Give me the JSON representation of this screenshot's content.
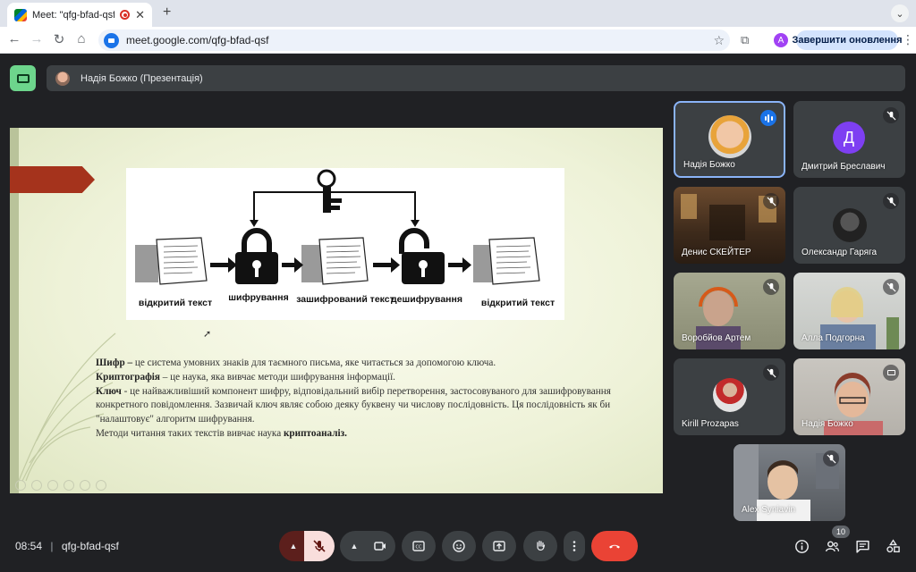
{
  "browser": {
    "tab_title": "Meet: \"qfg-bfad-qsf\"",
    "url": "meet.google.com/qfg-bfad-qsf",
    "profile_initial": "A",
    "update_label": "Завершити оновлення"
  },
  "presenter": {
    "label": "Надія Божко (Презентація)"
  },
  "slide": {
    "diagram_labels": {
      "plain_left": "відкритий текст",
      "encrypt": "шифрування",
      "cipher": "зашифрований текст",
      "decrypt": "дешифрування",
      "plain_right": "відкритий текст"
    },
    "paragraphs": [
      {
        "term": "Шифр –",
        "text": " це система умовних знаків для таємного письма, яке читається за допомогою ключа."
      },
      {
        "term": "Криптографія",
        "text": " – це наука, яка вивчає методи шифрування інформації."
      },
      {
        "term": "Ключ",
        "text": " - це найважливіший компонент шифру, відповідальний вибір перетворення, застосовуваного для зашифровування конкретного повідомлення. Зазвичай ключ являє собою деяку буквену чи числову послідовність. Ця послідовність як би \"налаштовує\" алгоритм шифрування."
      },
      {
        "term": "",
        "text": "Методи читання таких текстів вивчає наука ",
        "tail_bold": "криптоаналіз."
      }
    ]
  },
  "participants": [
    {
      "name": "Надія Божко",
      "state": "speaking"
    },
    {
      "name": "Дмитрий Бреславич",
      "state": "muted",
      "initial": "Д"
    },
    {
      "name": "Денис СКЕЙТЕР",
      "state": "muted"
    },
    {
      "name": "Олександр Гаряга",
      "state": "muted"
    },
    {
      "name": "Воробйов Артем",
      "state": "muted"
    },
    {
      "name": "Алла Подгорна",
      "state": "muted"
    },
    {
      "name": "Kirill Prozapas",
      "state": "muted"
    },
    {
      "name": "Надія Божко",
      "state": "presenting"
    },
    {
      "name": "Alex Syniavin",
      "state": "muted"
    }
  ],
  "meeting": {
    "time": "08:54",
    "separator": "|",
    "code": "qfg-bfad-qsf",
    "people_count": "10"
  },
  "colors": {
    "accent": "#8ab4f8",
    "end_call": "#ea4335",
    "mic_off_bg": "#f9dedc",
    "slide_tag": "#a5331c"
  }
}
